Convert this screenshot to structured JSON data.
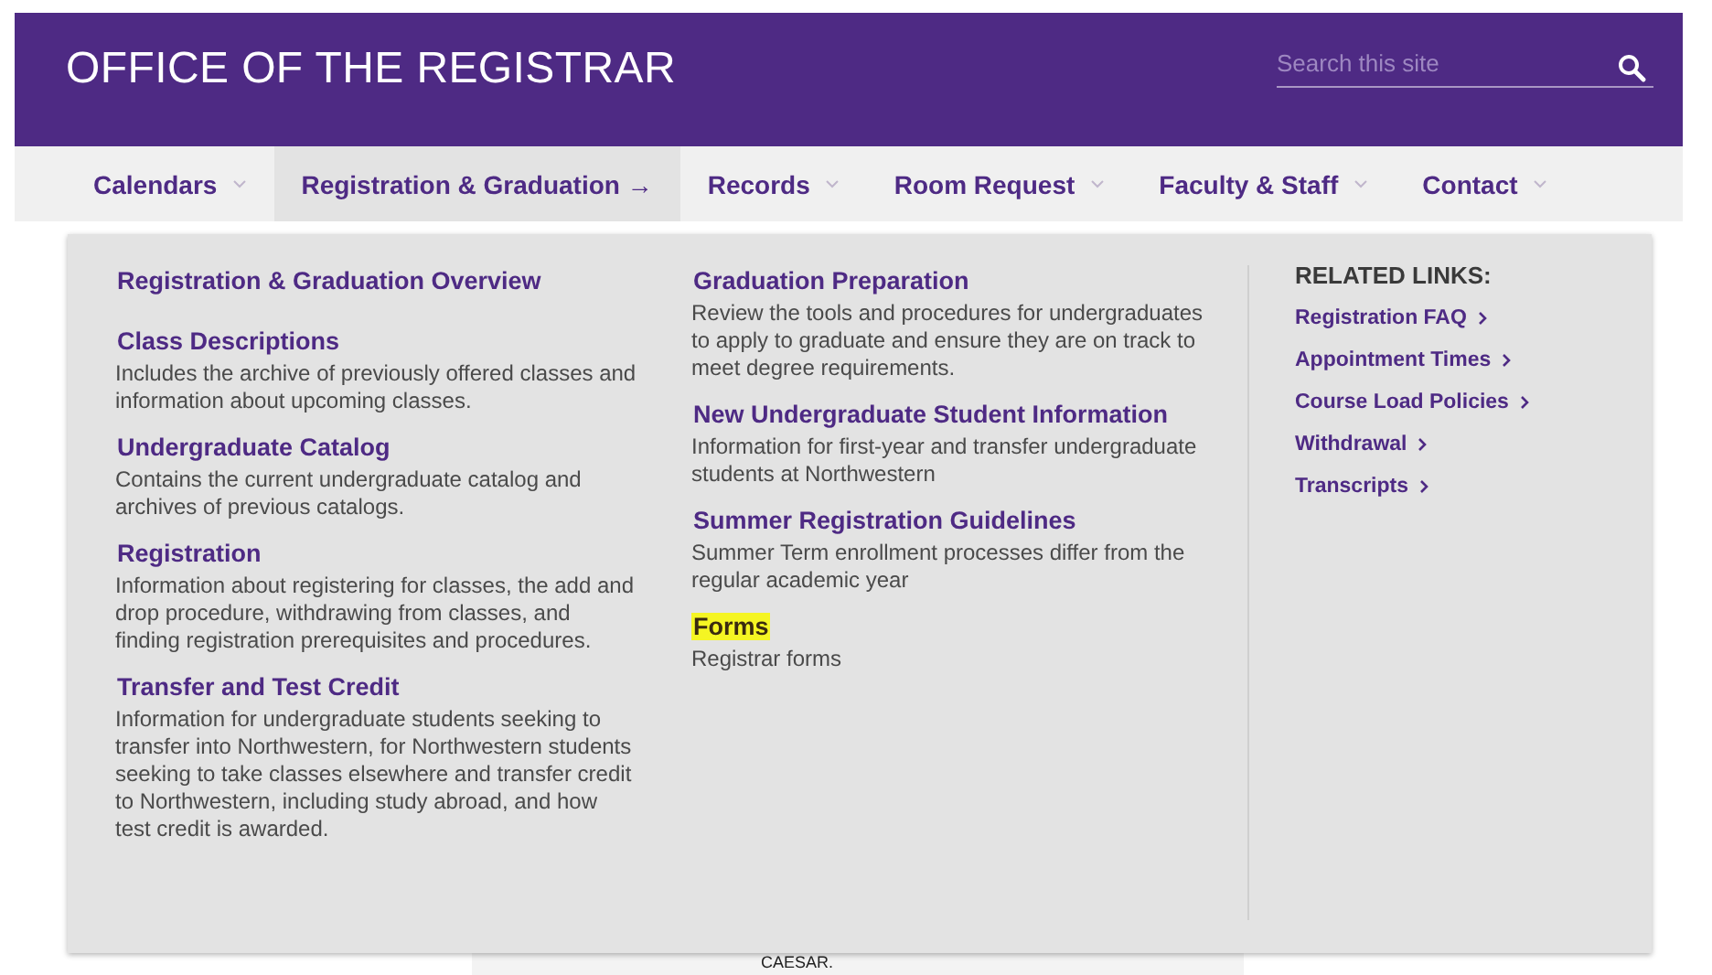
{
  "header": {
    "title": "OFFICE OF THE REGISTRAR",
    "search": {
      "placeholder": "Search this site"
    }
  },
  "nav": [
    {
      "label": "Calendars",
      "selected": false
    },
    {
      "label": "Registration & Graduation →",
      "selected": true
    },
    {
      "label": "Records",
      "selected": false
    },
    {
      "label": "Room Request",
      "selected": false
    },
    {
      "label": "Faculty & Staff",
      "selected": false
    },
    {
      "label": "Contact",
      "selected": false
    }
  ],
  "menu": {
    "columns": [
      [
        {
          "title": "Registration & Graduation Overview",
          "highlighted": false
        },
        {
          "title": "Class Descriptions",
          "description": "Includes the archive of previously offered classes and information about upcoming classes.",
          "highlighted": false
        },
        {
          "title": "Undergraduate Catalog",
          "description": "Contains the current undergraduate catalog and archives of previous catalogs.",
          "highlighted": false
        },
        {
          "title": "Registration",
          "description": "Information about registering for classes, the add and drop procedure, withdrawing from classes, and finding registration prerequisites and procedures.",
          "highlighted": false
        },
        {
          "title": "Transfer and Test Credit",
          "description": "Information for undergraduate students seeking to transfer into Northwestern, for Northwestern students seeking to take classes elsewhere and transfer credit to Northwestern, including study abroad, and how test credit is awarded.",
          "highlighted": false
        }
      ],
      [
        {
          "title": "Graduation Preparation",
          "description": "Review the tools and procedures for undergraduates to apply to graduate and ensure they are on track to meet degree requirements.",
          "highlighted": false
        },
        {
          "title": "New Undergraduate Student Information",
          "description": "Information for first-year and transfer undergraduate students at Northwestern",
          "highlighted": false
        },
        {
          "title": "Summer Registration Guidelines",
          "description": "Summer Term enrollment processes differ from the regular academic year",
          "highlighted": false
        },
        {
          "title": "Forms",
          "description": "Registrar forms",
          "highlighted": true
        }
      ]
    ],
    "related": {
      "heading": "RELATED LINKS:",
      "links": [
        "Registration FAQ",
        "Appointment Times",
        "Course Load Policies",
        "Withdrawal",
        "Transcripts"
      ]
    }
  },
  "page_text": "CAESAR."
}
